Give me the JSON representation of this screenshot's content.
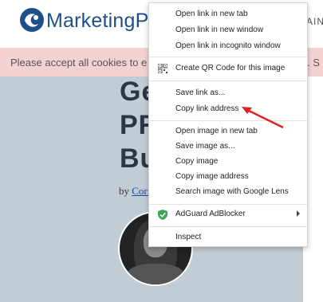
{
  "header": {
    "logo_text": "MarketingPr",
    "nav_partial": "AIN"
  },
  "cookie_banner": {
    "text": "Please accept all cookies to e",
    "trailing": ". S"
  },
  "article": {
    "headline_lines": [
      "Ge",
      "PR",
      "Bu"
    ],
    "byline_prefix": "by",
    "byline_author": "Cori"
  },
  "context_menu": {
    "items": [
      {
        "label": "Open link in new tab"
      },
      {
        "label": "Open link in new window"
      },
      {
        "label": "Open link in incognito window"
      },
      {
        "label": "Create QR Code for this image",
        "icon": "qr-code-icon"
      },
      {
        "label": "Save link as..."
      },
      {
        "label": "Copy link address"
      },
      {
        "label": "Open image in new tab"
      },
      {
        "label": "Save image as..."
      },
      {
        "label": "Copy image"
      },
      {
        "label": "Copy image address"
      },
      {
        "label": "Search image with Google Lens"
      },
      {
        "label": "AdGuard AdBlocker",
        "icon": "shield-icon",
        "submenu": true
      },
      {
        "label": "Inspect"
      }
    ]
  },
  "annotation": {
    "arrow_color": "#e02020",
    "points_to": "Copy link address"
  },
  "colors": {
    "brand": "#1d4f8b",
    "cookie_bg": "#f4d2d2",
    "hero_bg": "#c2ccd5",
    "adguard_green": "#3aa657"
  }
}
